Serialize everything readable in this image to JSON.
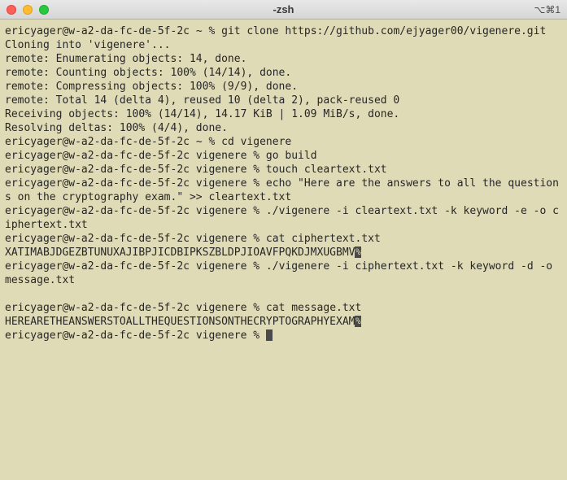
{
  "window": {
    "title": "-zsh",
    "shortcut": "⌥⌘1"
  },
  "prompt": {
    "user_host": "ericyager@w-a2-da-fc-de-5f-2c",
    "home_symbol": "~",
    "dir": "vigenere",
    "symbol": "%"
  },
  "session": {
    "cmd1": "git clone https://github.com/ejyager00/vigenere.git",
    "out1_1": "Cloning into 'vigenere'...",
    "out1_2": "remote: Enumerating objects: 14, done.",
    "out1_3": "remote: Counting objects: 100% (14/14), done.",
    "out1_4": "remote: Compressing objects: 100% (9/9), done.",
    "out1_5": "remote: Total 14 (delta 4), reused 10 (delta 2), pack-reused 0",
    "out1_6": "Receiving objects: 100% (14/14), 14.17 KiB | 1.09 MiB/s, done.",
    "out1_7": "Resolving deltas: 100% (4/4), done.",
    "cmd2": "cd vigenere",
    "cmd3": "go build",
    "cmd4": "touch cleartext.txt",
    "cmd5": "echo \"Here are the answers to all the questions on the cryptography exam.\" >> cleartext.txt",
    "cmd6": "./vigenere -i cleartext.txt -k keyword -e -o ciphertext.txt",
    "cmd7": "cat ciphertext.txt",
    "out7": "XATIMABJDGEZBTUNUXAJIBPJICDBIPKSZBLDPJIOAVFPQKDJMXUGBMV",
    "cmd8": "./vigenere -i ciphertext.txt -k keyword -d -o message.txt",
    "cmd9": "cat message.txt",
    "out9": "HEREARETHEANSWERSTOALLTHEQUESTIONSONTHECRYPTOGRAPHYEXAM",
    "trailing_char": "%"
  }
}
